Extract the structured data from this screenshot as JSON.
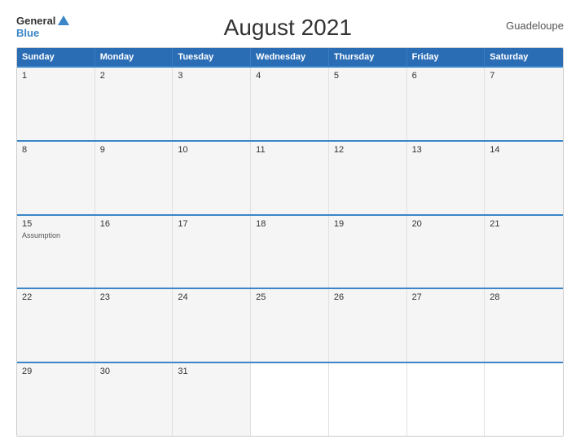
{
  "logo": {
    "general": "General",
    "blue": "Blue"
  },
  "title": "August 2021",
  "country": "Guadeloupe",
  "days_header": [
    "Sunday",
    "Monday",
    "Tuesday",
    "Wednesday",
    "Thursday",
    "Friday",
    "Saturday"
  ],
  "weeks": [
    [
      {
        "day": "1",
        "holiday": ""
      },
      {
        "day": "2",
        "holiday": ""
      },
      {
        "day": "3",
        "holiday": ""
      },
      {
        "day": "4",
        "holiday": ""
      },
      {
        "day": "5",
        "holiday": ""
      },
      {
        "day": "6",
        "holiday": ""
      },
      {
        "day": "7",
        "holiday": ""
      }
    ],
    [
      {
        "day": "8",
        "holiday": ""
      },
      {
        "day": "9",
        "holiday": ""
      },
      {
        "day": "10",
        "holiday": ""
      },
      {
        "day": "11",
        "holiday": ""
      },
      {
        "day": "12",
        "holiday": ""
      },
      {
        "day": "13",
        "holiday": ""
      },
      {
        "day": "14",
        "holiday": ""
      }
    ],
    [
      {
        "day": "15",
        "holiday": "Assumption"
      },
      {
        "day": "16",
        "holiday": ""
      },
      {
        "day": "17",
        "holiday": ""
      },
      {
        "day": "18",
        "holiday": ""
      },
      {
        "day": "19",
        "holiday": ""
      },
      {
        "day": "20",
        "holiday": ""
      },
      {
        "day": "21",
        "holiday": ""
      }
    ],
    [
      {
        "day": "22",
        "holiday": ""
      },
      {
        "day": "23",
        "holiday": ""
      },
      {
        "day": "24",
        "holiday": ""
      },
      {
        "day": "25",
        "holiday": ""
      },
      {
        "day": "26",
        "holiday": ""
      },
      {
        "day": "27",
        "holiday": ""
      },
      {
        "day": "28",
        "holiday": ""
      }
    ],
    [
      {
        "day": "29",
        "holiday": ""
      },
      {
        "day": "30",
        "holiday": ""
      },
      {
        "day": "31",
        "holiday": ""
      },
      {
        "day": "",
        "holiday": ""
      },
      {
        "day": "",
        "holiday": ""
      },
      {
        "day": "",
        "holiday": ""
      },
      {
        "day": "",
        "holiday": ""
      }
    ]
  ]
}
